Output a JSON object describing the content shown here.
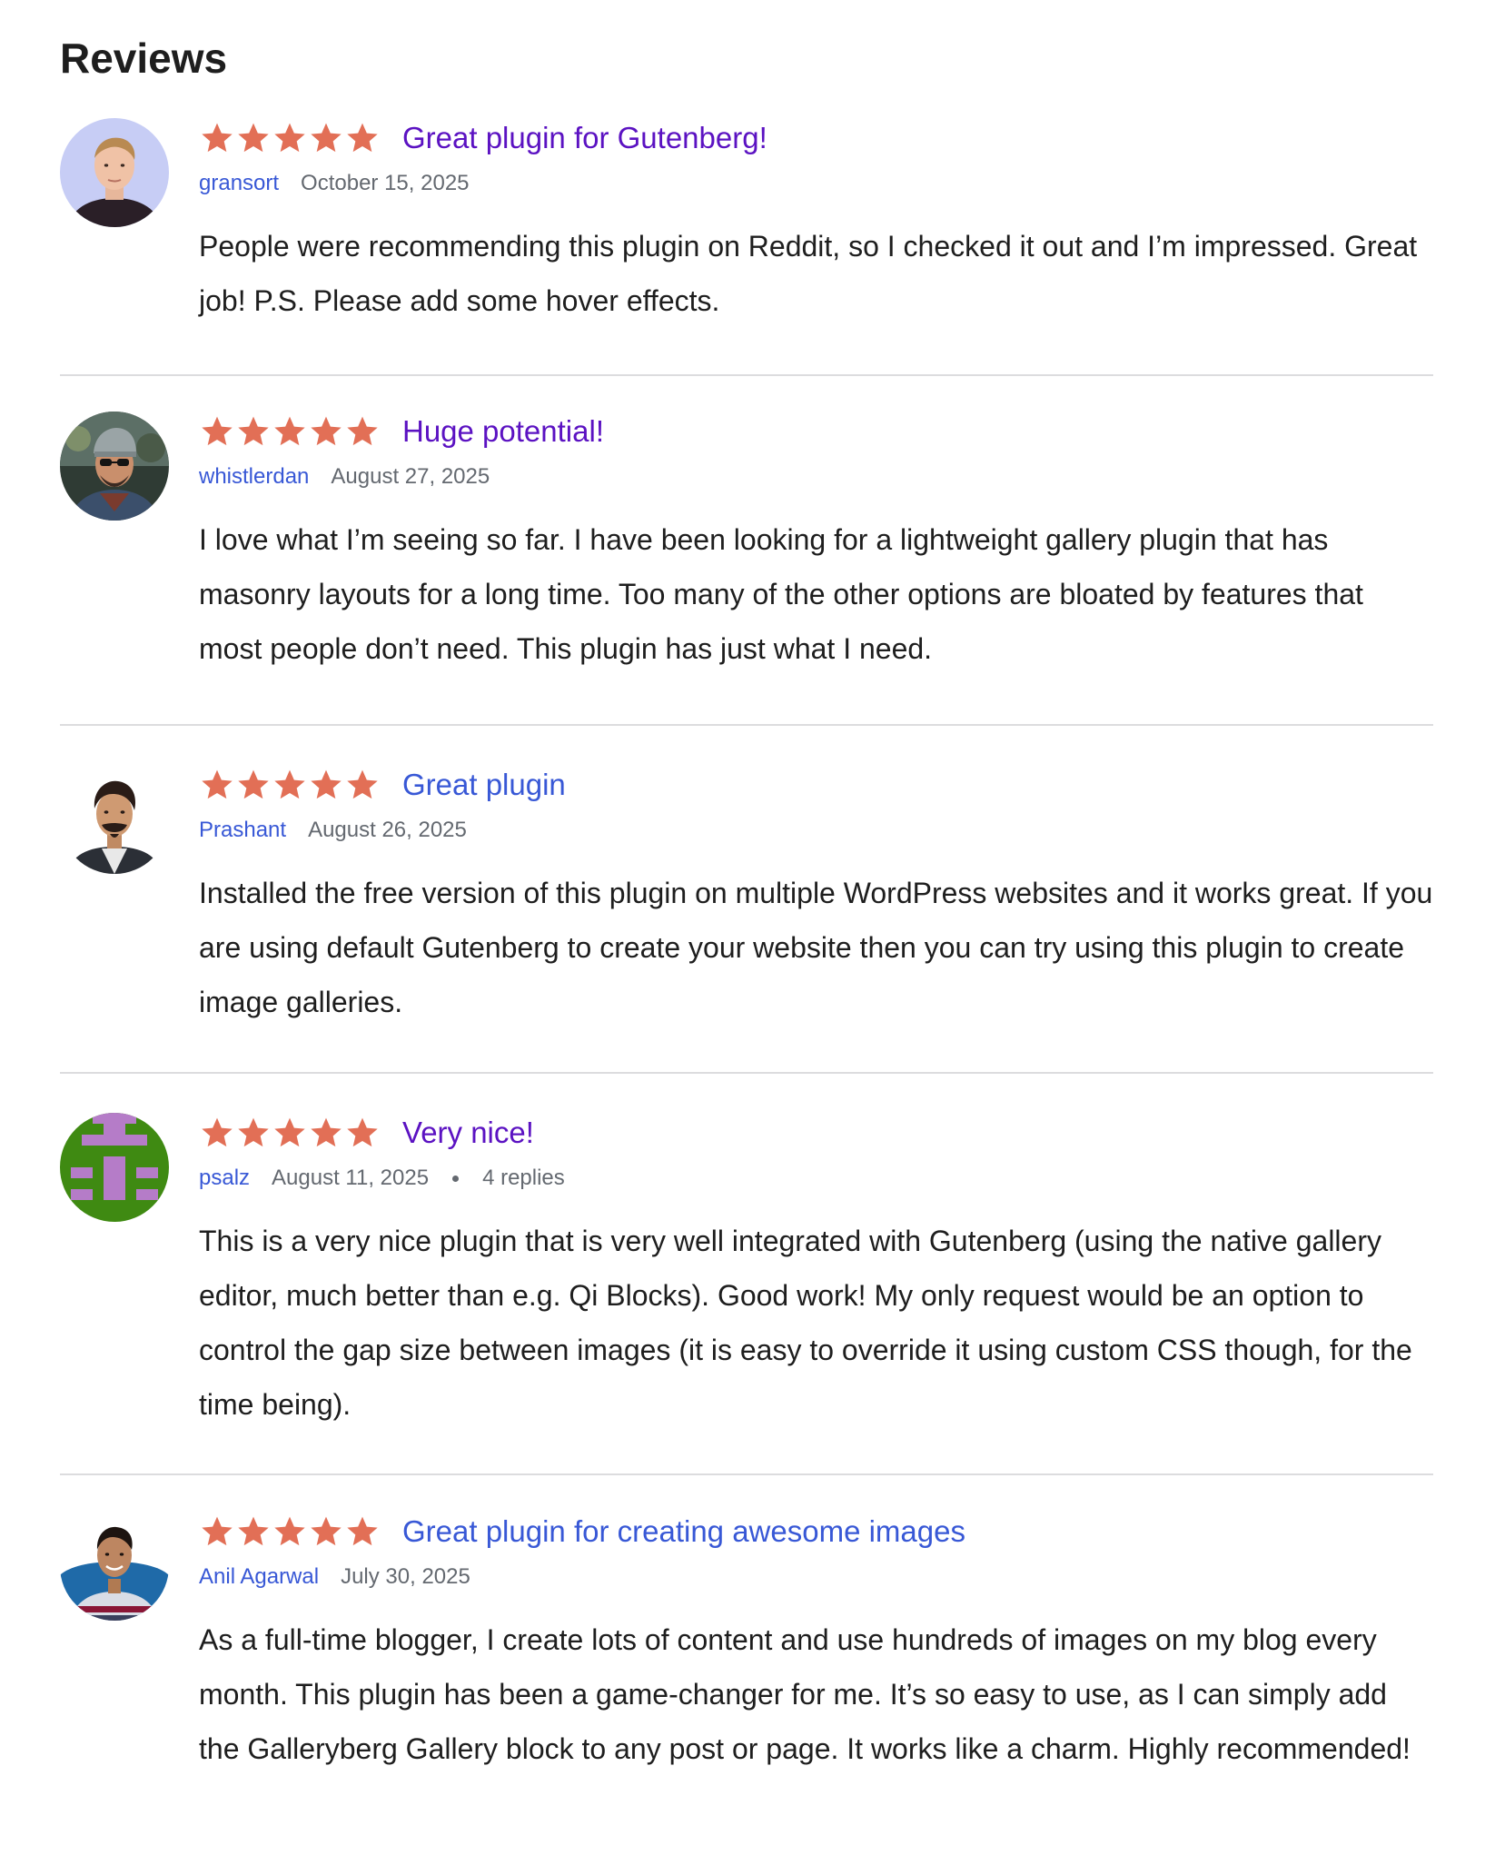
{
  "section_title": "Reviews",
  "colors": {
    "star": "#e26f56",
    "title_visited": "#5b12c2",
    "title_link": "#3858d6",
    "author": "#3858d6",
    "meta": "#646970",
    "divider": "#dcdcde"
  },
  "reviews": [
    {
      "rating": 5,
      "title": "Great plugin for Gutenberg!",
      "author": "gransort",
      "date": "October 15, 2025",
      "replies": "",
      "text": "People were recommending this plugin on Reddit, so I checked it out and I’m impressed. Great job! P.S. Please add some hover effects."
    },
    {
      "rating": 5,
      "title": "Huge potential!",
      "author": "whistlerdan",
      "date": "August 27, 2025",
      "replies": "",
      "text": "I love what I’m seeing so far. I have been looking for a lightweight gallery plugin that has masonry layouts for a long time. Too many of the other options are bloated by features that most people don’t need. This plugin has just what I need."
    },
    {
      "rating": 5,
      "title": "Great plugin",
      "author": "Prashant",
      "date": "August 26, 2025",
      "replies": "",
      "text": "Installed the free version of this plugin on multiple WordPress websites and it works great. If you are using default Gutenberg to create your website then you can try using this plugin to create image galleries."
    },
    {
      "rating": 5,
      "title": "Very nice!",
      "author": "psalz",
      "date": "August 11, 2025",
      "replies": "4 replies",
      "text": "This is a very nice plugin that is very well integrated with Gutenberg (using the native gallery editor, much better than e.g. Qi Blocks). Good work! My only request would be an option to control the gap size between images (it is easy to override it using custom CSS though, for the time being)."
    },
    {
      "rating": 5,
      "title": "Great plugin for creating awesome images",
      "author": "Anil Agarwal",
      "date": "July 30, 2025",
      "replies": "",
      "text": "As a full-time blogger, I create lots of content and use hundreds of images on my blog every month. This plugin has been a game-changer for me. It’s so easy to use, as I can simply add the Galleryberg Gallery block to any post or page. It works like a charm. Highly recommended!"
    }
  ]
}
